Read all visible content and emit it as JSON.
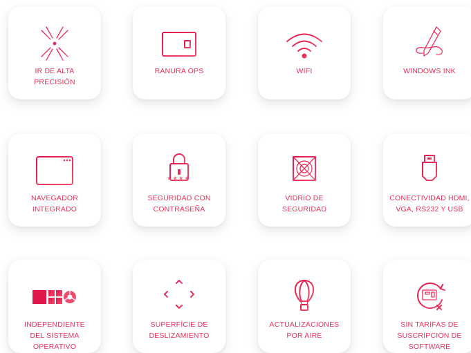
{
  "accent_colors": {
    "start": "#e0174a",
    "end": "#f04a6e"
  },
  "features": [
    {
      "icon": "laser-icon",
      "lines": [
        "IR DE ALTA",
        "PRECISIÓN"
      ]
    },
    {
      "icon": "ops-slot-icon",
      "lines": [
        "RANURA OPS"
      ]
    },
    {
      "icon": "wifi-icon",
      "lines": [
        "WIFI"
      ]
    },
    {
      "icon": "pen-icon",
      "lines": [
        "WINDOWS INK"
      ]
    },
    {
      "icon": "browser-window-icon",
      "lines": [
        "NAVEGADOR",
        "INTEGRADO"
      ]
    },
    {
      "icon": "padlock-password-icon",
      "lines": [
        "SEGURIDAD CON",
        "CONTRASEÑA"
      ],
      "password_mask": "****"
    },
    {
      "icon": "safety-glass-icon",
      "lines": [
        "VIDRIO DE",
        "SEGURIDAD"
      ]
    },
    {
      "icon": "hdmi-connector-icon",
      "lines": [
        "CONECTIVIDAD HDMI,",
        "VGA, RS232 Y USB"
      ]
    },
    {
      "icon": "os-logos-icon",
      "lines": [
        "INDEPENDIENTE",
        "DEL SISTEMA",
        "OPERATIVO"
      ]
    },
    {
      "icon": "swipe-arrows-icon",
      "lines": [
        "SUPERFÍCIE DE",
        "DESLIZAMIENTO"
      ]
    },
    {
      "icon": "hot-air-balloon-icon",
      "lines": [
        "ACTUALIZACIONES",
        "POR AIRE"
      ]
    },
    {
      "icon": "no-subscription-icon",
      "lines": [
        "SIN TARIFAS DE",
        "SUSCRIPCIÓN DE",
        "SOFTWARE"
      ]
    }
  ]
}
